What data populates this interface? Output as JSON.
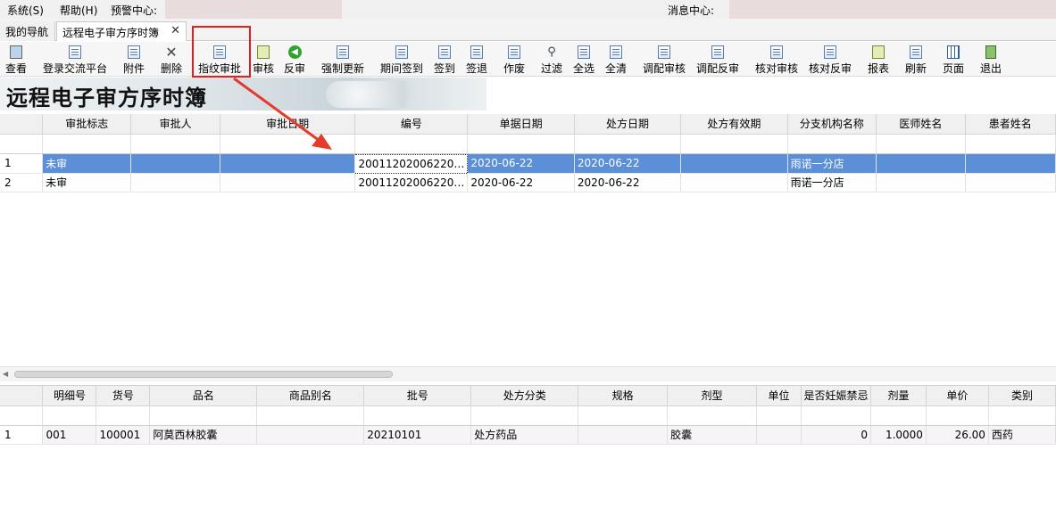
{
  "menubar": {
    "items": [
      "系统(S)",
      "帮助(H)",
      "预警中心:"
    ],
    "message_center": "消息中心:"
  },
  "tabs": [
    {
      "label": "我的导航"
    },
    {
      "label": "远程电子审方序时簿",
      "close": "✕"
    }
  ],
  "toolbar": {
    "buttons": [
      "查看",
      "登录交流平台",
      "附件",
      "删除",
      "指纹审批",
      "审核",
      "反审",
      "强制更新",
      "期间签到",
      "签到",
      "签退",
      "作废",
      "过滤",
      "全选",
      "全清",
      "调配审核",
      "调配反审",
      "核对审核",
      "核对反审",
      "报表",
      "刷新",
      "页面",
      "退出"
    ]
  },
  "page_title": "远程电子审方序时簿",
  "main_grid": {
    "columns": [
      "审批标志",
      "审批人",
      "审批日期",
      "编号",
      "单据日期",
      "处方日期",
      "处方有效期",
      "分支机构名称",
      "医师姓名",
      "患者姓名"
    ],
    "rows": [
      {
        "rn": "1",
        "cells": [
          "未审",
          "",
          "",
          "20011202006220…",
          "2020-06-22",
          "2020-06-22",
          "",
          "雨诺一分店",
          "",
          ""
        ]
      },
      {
        "rn": "2",
        "cells": [
          "未审",
          "",
          "",
          "20011202006220…",
          "2020-06-22",
          "2020-06-22",
          "",
          "雨诺一分店",
          "",
          ""
        ]
      }
    ]
  },
  "detail_grid": {
    "columns": [
      "明细号",
      "货号",
      "品名",
      "商品别名",
      "批号",
      "处方分类",
      "规格",
      "剂型",
      "单位",
      "是否妊娠禁忌",
      "剂量",
      "单价",
      "类别"
    ],
    "rows": [
      {
        "rn": "1",
        "cells": [
          "001",
          "100001",
          "阿莫西林胶囊",
          "",
          "20210101",
          "处方药品",
          "",
          "胶囊",
          "",
          "0",
          "1.0000",
          "26.00",
          "西药"
        ]
      }
    ]
  },
  "colors": {
    "selection": "#5b8fd8",
    "annotation": "#e02020"
  }
}
